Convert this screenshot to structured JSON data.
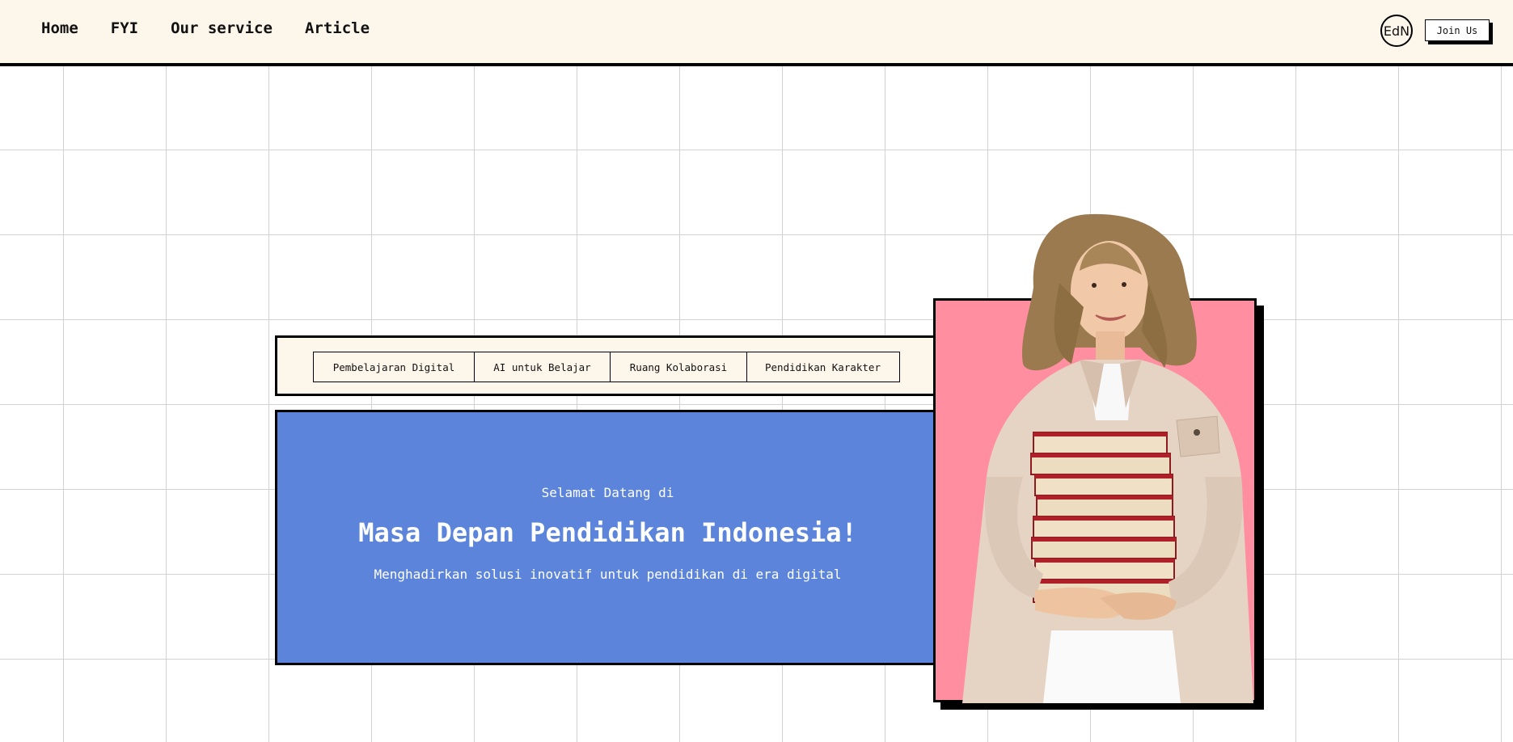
{
  "nav": {
    "links": [
      "Home",
      "FYI",
      "Our service",
      "Article"
    ],
    "logo_text": "EdN",
    "join_label": "Join Us"
  },
  "tags": [
    "Pembelajaran Digital",
    "AI untuk Belajar",
    "Ruang Kolaborasi",
    "Pendidikan Karakter"
  ],
  "hero": {
    "kicker": "Selamat Datang di",
    "title": "Masa Depan Pendidikan Indonesia!",
    "subtitle": "Menghadirkan solusi inovatif untuk pendidikan di era digital"
  },
  "colors": {
    "nav_bg": "#fdf6eb",
    "hero_bg": "#5b84da",
    "photo_bg": "#ff8ea1",
    "grid_line": "#d2d2d2"
  },
  "icons": {
    "logo": "edn-logo-icon",
    "photo": "student-with-books-photo"
  }
}
